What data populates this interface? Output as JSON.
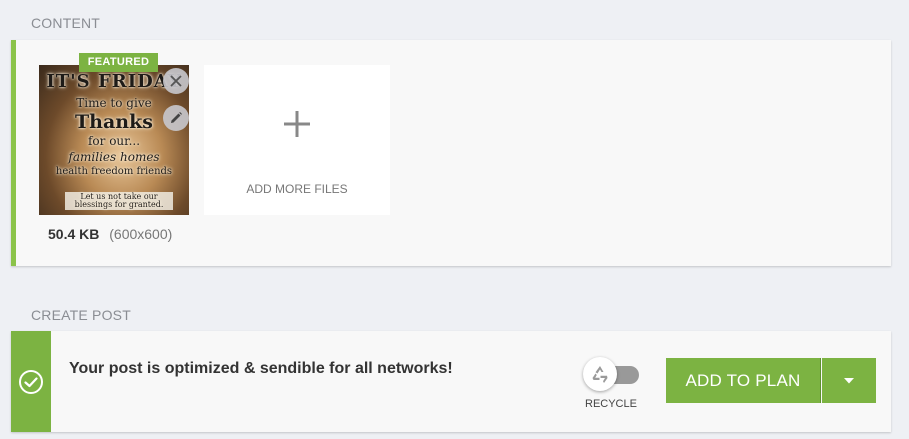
{
  "content_section": {
    "label": "CONTENT",
    "featured_badge": "FEATURED",
    "image": {
      "line1": "IT'S FRIDAY",
      "line2": "Time to give",
      "line3": "Thanks",
      "line4": "for our...",
      "line5": "families  homes",
      "line6": "health  freedom  friends",
      "line7": "Let us not take our blessings for granted."
    },
    "file_size": "50.4 KB",
    "file_dims": "(600x600)",
    "add_files_label": "ADD MORE FILES"
  },
  "create_section": {
    "label": "CREATE POST",
    "status_message": "Your post is optimized & sendible for all networks!",
    "recycle_label": "RECYCLE",
    "add_to_plan_label": "ADD TO PLAN"
  },
  "icons": {
    "close": "close-icon",
    "edit": "pencil-icon",
    "add": "plus-icon",
    "status": "check-circle-icon",
    "recycle": "recycle-icon",
    "dropdown": "caret-down-icon"
  },
  "colors": {
    "accent": "#7cb342",
    "background": "#eef0f4",
    "card": "#f8f8f8"
  }
}
